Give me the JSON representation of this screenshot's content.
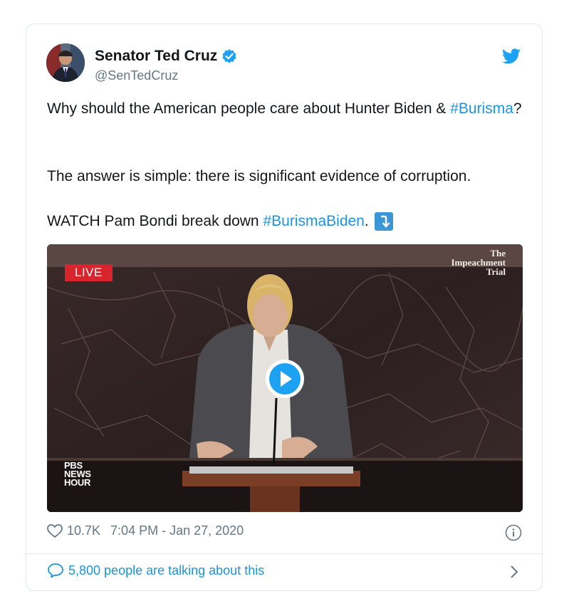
{
  "tweet": {
    "display_name": "Senator Ted Cruz",
    "handle": "@SenTedCruz",
    "line1_prefix": "Why should the American people care about Hunter Biden &",
    "line1_hashtag": "#Burisma",
    "line1_suffix": "?",
    "line2": "The answer is simple: there is significant evidence of corruption.",
    "line3_prefix": "WATCH Pam Bondi break down",
    "line3_hashtag": "#BurismaBiden",
    "line3_suffix": "."
  },
  "media": {
    "live_label": "LIVE",
    "watermark_line1": "The",
    "watermark_line2": "Impeachment",
    "watermark_line3": "Trial",
    "pbs_line1": "PBS",
    "pbs_line2": "NEWS",
    "pbs_line3": "HOUR"
  },
  "footer": {
    "likes": "10.7K",
    "timestamp": "7:04 PM - Jan 27, 2020",
    "talking": "5,800 people are talking about this"
  },
  "colors": {
    "link": "#1b95e0",
    "verified": "#1da1f2",
    "live": "#d8242d"
  },
  "icons": [
    "verified-badge-icon",
    "twitter-bird-icon",
    "arrow-down-icon",
    "play-icon",
    "heart-icon",
    "info-icon",
    "comment-bubble-icon",
    "chevron-right-icon"
  ]
}
